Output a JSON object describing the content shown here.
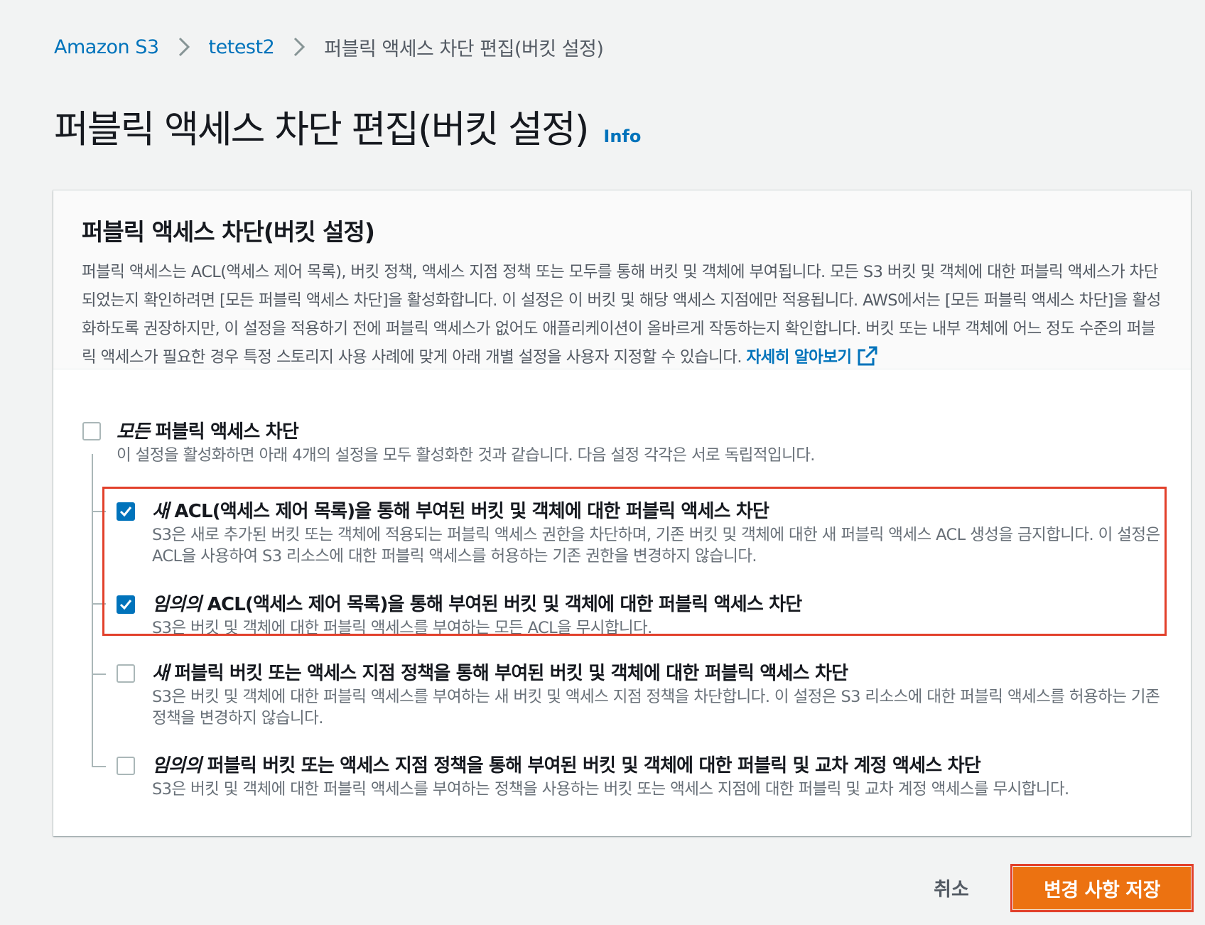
{
  "breadcrumb": {
    "items": [
      "Amazon S3",
      "tetest2"
    ],
    "current": "퍼블릭 액세스 차단 편집(버킷 설정)"
  },
  "page": {
    "title": "퍼블릭 액세스 차단 편집(버킷 설정)",
    "info_link": "Info"
  },
  "panel": {
    "title": "퍼블릭 액세스 차단(버킷 설정)",
    "description": "퍼블릭 액세스는 ACL(액세스 제어 목록), 버킷 정책, 액세스 지점 정책 또는 모두를 통해 버킷 및 객체에 부여됩니다. 모든 S3 버킷 및 객체에 대한 퍼블릭 액세스가 차단되었는지 확인하려면 [모든 퍼블릭 액세스 차단]을 활성화합니다. 이 설정은 이 버킷 및 해당 액세스 지점에만 적용됩니다. AWS에서는 [모든 퍼블릭 액세스 차단]을 활성화하도록 권장하지만, 이 설정을 적용하기 전에 퍼블릭 액세스가 없어도 애플리케이션이 올바르게 작동하는지 확인합니다. 버킷 또는 내부 객체에 어느 정도 수준의 퍼블릭 액세스가 필요한 경우 특정 스토리지 사용 사례에 맞게 아래 개별 설정을 사용자 지정할 수 있습니다.",
    "learn_more": "자세히 알아보기"
  },
  "options": [
    {
      "emphasis": "모든",
      "label": "퍼블릭 액세스 차단",
      "description": "이 설정을 활성화하면 아래 4개의 설정을 모두 활성화한 것과 같습니다. 다음 설정 각각은 서로 독립적입니다.",
      "checked": false
    },
    {
      "emphasis": "새",
      "label": "ACL(액세스 제어 목록)을 통해 부여된 버킷 및 객체에 대한 퍼블릭 액세스 차단",
      "description": "S3은 새로 추가된 버킷 또는 객체에 적용되는 퍼블릭 액세스 권한을 차단하며, 기존 버킷 및 객체에 대한 새 퍼블릭 액세스 ACL 생성을 금지합니다. 이 설정은 ACL을 사용하여 S3 리소스에 대한 퍼블릭 액세스를 허용하는 기존 권한을 변경하지 않습니다.",
      "checked": true
    },
    {
      "emphasis": "임의의",
      "label": "ACL(액세스 제어 목록)을 통해 부여된 버킷 및 객체에 대한 퍼블릭 액세스 차단",
      "description": "S3은 버킷 및 객체에 대한 퍼블릭 액세스를 부여하는 모든 ACL을 무시합니다.",
      "checked": true
    },
    {
      "emphasis": "새",
      "label": "퍼블릭 버킷 또는 액세스 지점 정책을 통해 부여된 버킷 및 객체에 대한 퍼블릭 액세스 차단",
      "description": "S3은 버킷 및 객체에 대한 퍼블릭 액세스를 부여하는 새 버킷 및 액세스 지점 정책을 차단합니다. 이 설정은 S3 리소스에 대한 퍼블릭 액세스를 허용하는 기존 정책을 변경하지 않습니다.",
      "checked": false
    },
    {
      "emphasis": "임의의",
      "label": "퍼블릭 버킷 또는 액세스 지점 정책을 통해 부여된 버킷 및 객체에 대한 퍼블릭 및 교차 계정 액세스 차단",
      "description": "S3은 버킷 및 객체에 대한 퍼블릭 액세스를 부여하는 정책을 사용하는 버킷 또는 액세스 지점에 대한 퍼블릭 및 교차 계정 액세스를 무시합니다.",
      "checked": false
    }
  ],
  "footer": {
    "cancel_label": "취소",
    "save_label": "변경 사항 저장"
  },
  "colors": {
    "link": "#0073bb",
    "primary_button": "#ec7211",
    "highlight": "#e2402b",
    "checkbox_checked": "#0073bb"
  }
}
